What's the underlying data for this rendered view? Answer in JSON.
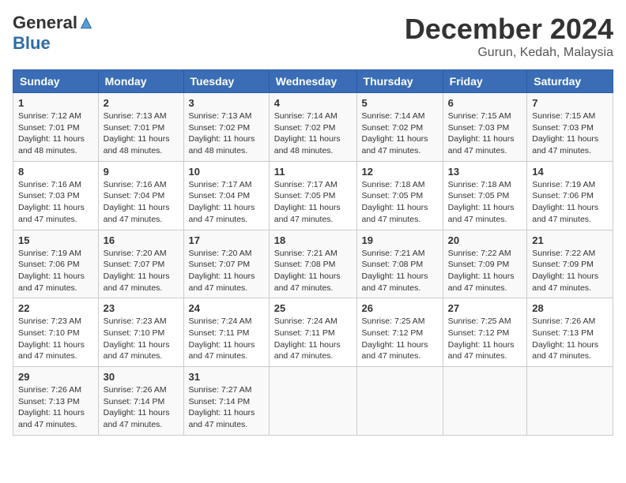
{
  "header": {
    "logo_general": "General",
    "logo_blue": "Blue",
    "month_title": "December 2024",
    "location": "Gurun, Kedah, Malaysia"
  },
  "calendar": {
    "weekdays": [
      "Sunday",
      "Monday",
      "Tuesday",
      "Wednesday",
      "Thursday",
      "Friday",
      "Saturday"
    ],
    "weeks": [
      [
        null,
        {
          "day": 2,
          "sunrise": "7:13 AM",
          "sunset": "7:01 PM",
          "daylight": "11 hours and 48 minutes."
        },
        {
          "day": 3,
          "sunrise": "7:13 AM",
          "sunset": "7:02 PM",
          "daylight": "11 hours and 48 minutes."
        },
        {
          "day": 4,
          "sunrise": "7:14 AM",
          "sunset": "7:02 PM",
          "daylight": "11 hours and 48 minutes."
        },
        {
          "day": 5,
          "sunrise": "7:14 AM",
          "sunset": "7:02 PM",
          "daylight": "11 hours and 47 minutes."
        },
        {
          "day": 6,
          "sunrise": "7:15 AM",
          "sunset": "7:03 PM",
          "daylight": "11 hours and 47 minutes."
        },
        {
          "day": 7,
          "sunrise": "7:15 AM",
          "sunset": "7:03 PM",
          "daylight": "11 hours and 47 minutes."
        }
      ],
      [
        {
          "day": 8,
          "sunrise": "7:16 AM",
          "sunset": "7:03 PM",
          "daylight": "11 hours and 47 minutes."
        },
        {
          "day": 9,
          "sunrise": "7:16 AM",
          "sunset": "7:04 PM",
          "daylight": "11 hours and 47 minutes."
        },
        {
          "day": 10,
          "sunrise": "7:17 AM",
          "sunset": "7:04 PM",
          "daylight": "11 hours and 47 minutes."
        },
        {
          "day": 11,
          "sunrise": "7:17 AM",
          "sunset": "7:05 PM",
          "daylight": "11 hours and 47 minutes."
        },
        {
          "day": 12,
          "sunrise": "7:18 AM",
          "sunset": "7:05 PM",
          "daylight": "11 hours and 47 minutes."
        },
        {
          "day": 13,
          "sunrise": "7:18 AM",
          "sunset": "7:05 PM",
          "daylight": "11 hours and 47 minutes."
        },
        {
          "day": 14,
          "sunrise": "7:19 AM",
          "sunset": "7:06 PM",
          "daylight": "11 hours and 47 minutes."
        }
      ],
      [
        {
          "day": 15,
          "sunrise": "7:19 AM",
          "sunset": "7:06 PM",
          "daylight": "11 hours and 47 minutes."
        },
        {
          "day": 16,
          "sunrise": "7:20 AM",
          "sunset": "7:07 PM",
          "daylight": "11 hours and 47 minutes."
        },
        {
          "day": 17,
          "sunrise": "7:20 AM",
          "sunset": "7:07 PM",
          "daylight": "11 hours and 47 minutes."
        },
        {
          "day": 18,
          "sunrise": "7:21 AM",
          "sunset": "7:08 PM",
          "daylight": "11 hours and 47 minutes."
        },
        {
          "day": 19,
          "sunrise": "7:21 AM",
          "sunset": "7:08 PM",
          "daylight": "11 hours and 47 minutes."
        },
        {
          "day": 20,
          "sunrise": "7:22 AM",
          "sunset": "7:09 PM",
          "daylight": "11 hours and 47 minutes."
        },
        {
          "day": 21,
          "sunrise": "7:22 AM",
          "sunset": "7:09 PM",
          "daylight": "11 hours and 47 minutes."
        }
      ],
      [
        {
          "day": 22,
          "sunrise": "7:23 AM",
          "sunset": "7:10 PM",
          "daylight": "11 hours and 47 minutes."
        },
        {
          "day": 23,
          "sunrise": "7:23 AM",
          "sunset": "7:10 PM",
          "daylight": "11 hours and 47 minutes."
        },
        {
          "day": 24,
          "sunrise": "7:24 AM",
          "sunset": "7:11 PM",
          "daylight": "11 hours and 47 minutes."
        },
        {
          "day": 25,
          "sunrise": "7:24 AM",
          "sunset": "7:11 PM",
          "daylight": "11 hours and 47 minutes."
        },
        {
          "day": 26,
          "sunrise": "7:25 AM",
          "sunset": "7:12 PM",
          "daylight": "11 hours and 47 minutes."
        },
        {
          "day": 27,
          "sunrise": "7:25 AM",
          "sunset": "7:12 PM",
          "daylight": "11 hours and 47 minutes."
        },
        {
          "day": 28,
          "sunrise": "7:26 AM",
          "sunset": "7:13 PM",
          "daylight": "11 hours and 47 minutes."
        }
      ],
      [
        {
          "day": 29,
          "sunrise": "7:26 AM",
          "sunset": "7:13 PM",
          "daylight": "11 hours and 47 minutes."
        },
        {
          "day": 30,
          "sunrise": "7:26 AM",
          "sunset": "7:14 PM",
          "daylight": "11 hours and 47 minutes."
        },
        {
          "day": 31,
          "sunrise": "7:27 AM",
          "sunset": "7:14 PM",
          "daylight": "11 hours and 47 minutes."
        },
        null,
        null,
        null,
        null
      ]
    ],
    "week0_day1": {
      "day": 1,
      "sunrise": "7:12 AM",
      "sunset": "7:01 PM",
      "daylight": "11 hours and 48 minutes."
    }
  }
}
